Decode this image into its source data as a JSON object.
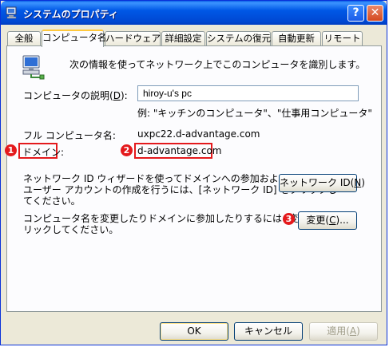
{
  "window": {
    "title": "システムのプロパティ"
  },
  "tabs": [
    {
      "label": "全般"
    },
    {
      "label": "コンピュータ名"
    },
    {
      "label": "ハードウェア"
    },
    {
      "label": "詳細設定"
    },
    {
      "label": "システムの復元"
    },
    {
      "label": "自動更新"
    },
    {
      "label": "リモート"
    }
  ],
  "panel": {
    "intro": "次の情報を使ってネットワーク上でこのコンピュータを識別します。",
    "desc_label_pre": "コンピュータの説明(",
    "desc_label_key": "D",
    "desc_label_post": "):",
    "desc_value": "hiroy-u's pc",
    "example": "例: \"キッチンのコンピュータ\"、\"仕事用コンピュータ\"",
    "fullname_label": "フル コンピュータ名:",
    "fullname_value": "uxpc22.d-advantage.com",
    "domain_label": "ドメイン:",
    "domain_value": "d-advantage.com",
    "netid_text_1": "ネットワーク ID ウィザードを使ってドメインへの参加およびローカル",
    "netid_text_2": "ユーザー アカウントの作成を行うには、[ネットワーク ID] をクリックし",
    "netid_text_3": "てください。",
    "netid_button_pre": "ネットワーク ID(",
    "netid_button_key": "N",
    "netid_button_post": ")",
    "change_text_1": "コンピュータ名を変更したりドメインに参加したりするには [変更] をク",
    "change_text_2": "リックしてください。",
    "change_button_pre": "変更(",
    "change_button_key": "C",
    "change_button_post": ")...",
    "markers": [
      "1",
      "2",
      "3"
    ],
    "marker_color": "#e4191c"
  },
  "footer": {
    "ok": "OK",
    "cancel": "キャンセル",
    "apply_pre": "適用(",
    "apply_key": "A",
    "apply_post": ")"
  }
}
